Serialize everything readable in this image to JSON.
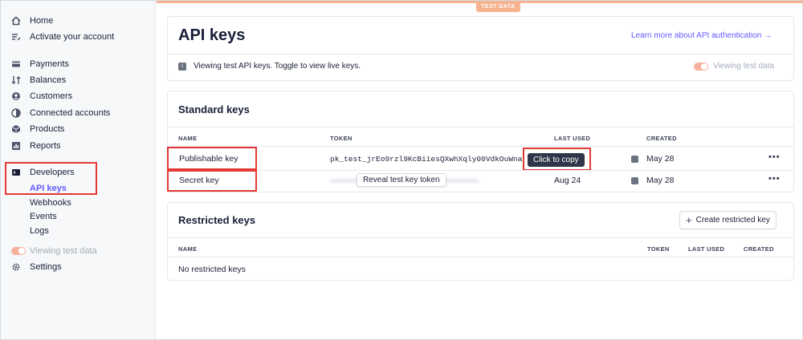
{
  "sidebar": {
    "home": "Home",
    "activate": "Activate your account",
    "payments": "Payments",
    "balances": "Balances",
    "customers": "Customers",
    "connected": "Connected accounts",
    "products": "Products",
    "reports": "Reports",
    "developers": "Developers",
    "api_keys": "API keys",
    "webhooks": "Webhooks",
    "events": "Events",
    "logs": "Logs",
    "viewing_test": "Viewing test data",
    "settings": "Settings"
  },
  "banner": {
    "test_tag": "TEST DATA"
  },
  "header": {
    "title": "API keys",
    "learn_more": "Learn more about API authentication →",
    "info": "Viewing test API keys. Toggle to view live keys.",
    "toggle_label": "Viewing test data"
  },
  "standard": {
    "title": "Standard keys",
    "columns": {
      "name": "NAME",
      "token": "TOKEN",
      "last_used": "LAST USED",
      "created": "CREATED"
    },
    "rows": [
      {
        "name": "Publishable key",
        "token": "pk_test_jrEo9rzl9KcBiiesQXwhXqly00VdkOuWna",
        "last_used": "",
        "created": "May 28"
      },
      {
        "name": "Secret key",
        "token": "",
        "last_used": "Aug 24",
        "created": "May 28"
      }
    ],
    "copy_tooltip": "Click to copy",
    "reveal_tooltip": "Reveal test key token",
    "more": "•••"
  },
  "restricted": {
    "title": "Restricted keys",
    "create_button": "Create restricted key",
    "columns": {
      "name": "NAME",
      "token": "TOKEN",
      "last_used": "LAST USED",
      "created": "CREATED"
    },
    "empty": "No restricted keys"
  },
  "colors": {
    "accent": "#635bff",
    "test": "#f7b28f",
    "highlight": "#e53935"
  }
}
